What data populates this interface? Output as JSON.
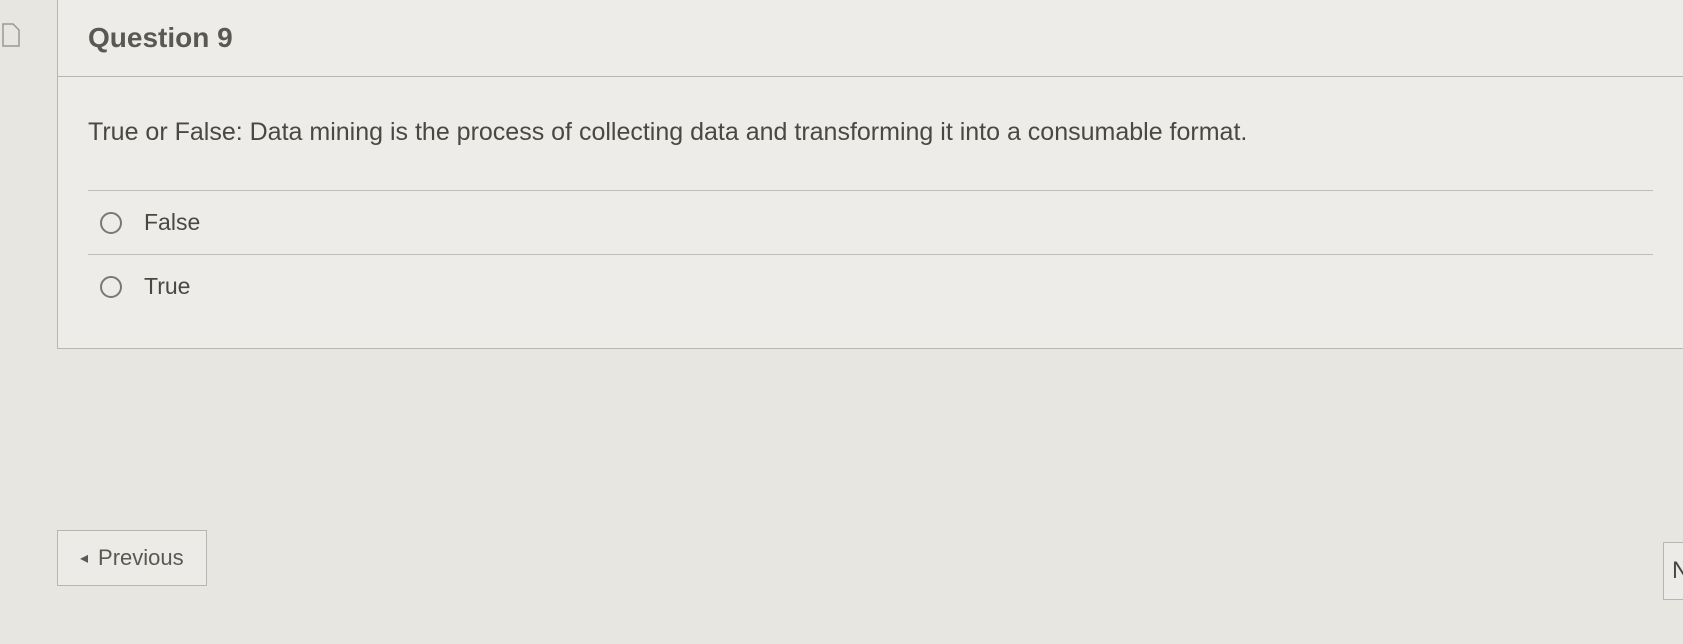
{
  "question": {
    "title": "Question 9",
    "prompt": "True or False: Data mining is the process of collecting data and transforming it into a consumable format.",
    "options": [
      {
        "label": "False"
      },
      {
        "label": "True"
      }
    ]
  },
  "nav": {
    "previous_label": "Previous",
    "next_partial": "N"
  }
}
